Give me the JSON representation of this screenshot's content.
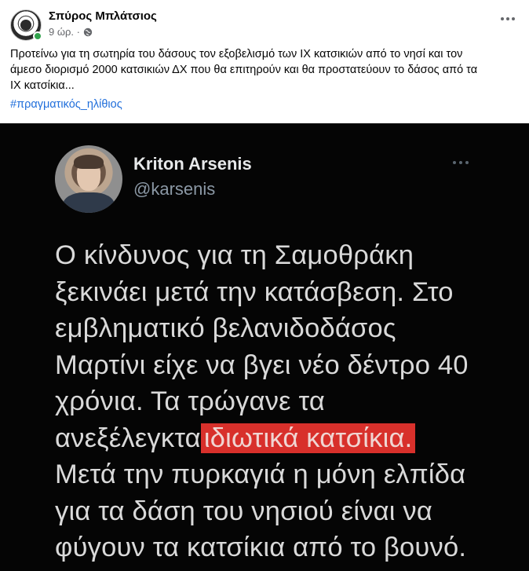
{
  "post": {
    "author": "Σπύρος Μπλάτσιος",
    "time": "9 ώρ. ·",
    "text_lines": [
      "Προτείνω για τη σωτηρία του δάσους τον εξοβελισμό των ΙΧ κατσικιών από το νησί και τον",
      "άμεσο διορισμό 2000 κατσικιών ΔΧ που θα επιτηρούν και θα προστατεύουν το δάσος από τα",
      "ΙΧ κατσίκια..."
    ],
    "hashtag": "#πραγματικός_ηλίθιος"
  },
  "tweet": {
    "name": "Kriton Arsenis",
    "handle": "@karsenis",
    "lines": [
      "Ο κίνδυνος για τη Σαμοθράκη",
      "ξεκινάει μετά την κατάσβεση. Στο",
      "εμβληματικό βελανιδοδάσος",
      "Μαρτίνι είχε να βγει νέο δέντρο 40",
      "χρόνια. Τα τρώγανε τα",
      "Μετά την πυρκαγιά η μόνη ελπίδα",
      "για τα δάση του νησιού είναι να",
      "φύγουν τα κατσίκια από το βουνό."
    ],
    "line6_prefix": "ανεξέλεγκτα",
    "line6_highlight": "ιδιωτικά κατσίκια."
  },
  "colors": {
    "link": "#216fdb",
    "online": "#31a24c",
    "highlight": "#d8302b"
  },
  "icons": [
    "globe-icon",
    "more-options-icon",
    "tweet-more-icon"
  ]
}
